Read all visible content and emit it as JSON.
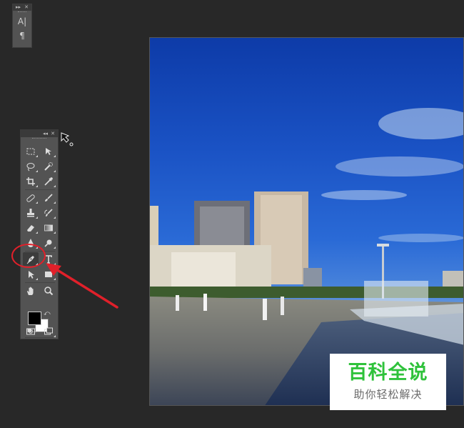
{
  "character_panel": {
    "collapse_glyph": "▸▸",
    "close_glyph": "✕",
    "buttons": [
      {
        "icon": "character-icon",
        "glyph": "A|"
      },
      {
        "icon": "paragraph-icon",
        "glyph": "¶"
      }
    ]
  },
  "tools_panel": {
    "collapse_glyph": "◂◂",
    "close_glyph": "✕",
    "active_tool": "pen-tool",
    "colors": {
      "foreground": "#000000",
      "background": "#ffffff"
    },
    "swap_glyph": "⤺",
    "default_colors_glyph": "■□"
  },
  "annotation": {
    "color": "#e0202a"
  },
  "watermark": {
    "title": "百科全说",
    "subtitle": "助你轻松解决",
    "title_color": "#2fc23b"
  }
}
